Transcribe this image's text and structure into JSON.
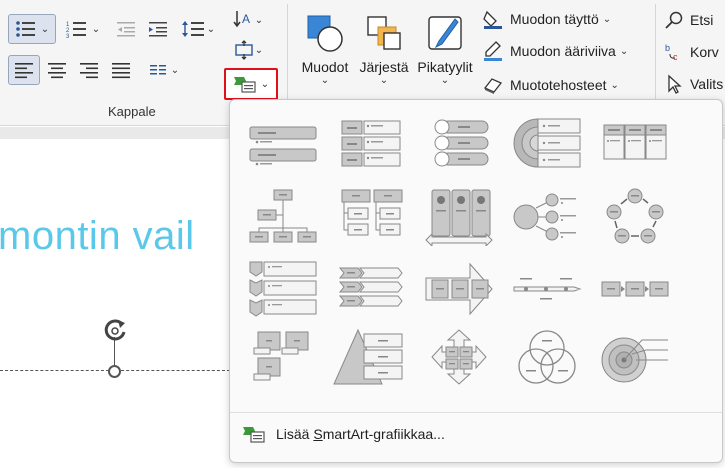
{
  "ribbon": {
    "paragraph_group_label": "Kappale",
    "arrange_label": "Muodot",
    "arrange2_label": "Järjestä",
    "quickstyles_label": "Pikatyylit",
    "shape_fill_label": "Muodon täyttö",
    "shape_outline_label": "Muodon ääriviiva",
    "shape_effects_label": "Muototehosteet",
    "find_label": "Etsi",
    "replace_label": "Korv",
    "select_label": "Valits"
  },
  "slide": {
    "title_fragment": "montin vail"
  },
  "smartart_menu": {
    "footer_label_pre": "Lisää ",
    "footer_label_u": "S",
    "footer_label_post": "martArt-grafiikkaa..."
  },
  "colors": {
    "accent_red": "#e0101b",
    "title_blue": "#5ac8ea",
    "smartart_green": "#3a9a3a"
  }
}
